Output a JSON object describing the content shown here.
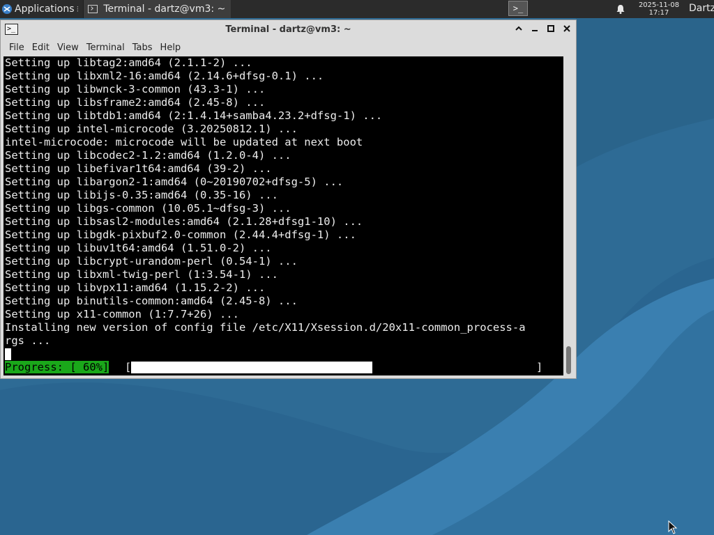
{
  "panel": {
    "applications_label": "Applications",
    "task_title": "Terminal - dartz@vm3: ~",
    "terminal_launcher": ">_",
    "clock_date": "2025-11-08",
    "clock_time": "17:17",
    "user": "Dartz"
  },
  "window": {
    "title": "Terminal - dartz@vm3: ~",
    "menu": [
      "File",
      "Edit",
      "View",
      "Terminal",
      "Tabs",
      "Help"
    ]
  },
  "terminal": {
    "lines": [
      "Setting up libtag2:amd64 (2.1.1-2) ...",
      "Setting up libxml2-16:amd64 (2.14.6+dfsg-0.1) ...",
      "Setting up libwnck-3-common (43.3-1) ...",
      "Setting up libsframe2:amd64 (2.45-8) ...",
      "Setting up libtdb1:amd64 (2:1.4.14+samba4.23.2+dfsg-1) ...",
      "Setting up intel-microcode (3.20250812.1) ...",
      "intel-microcode: microcode will be updated at next boot",
      "Setting up libcodec2-1.2:amd64 (1.2.0-4) ...",
      "Setting up libefivar1t64:amd64 (39-2) ...",
      "Setting up libargon2-1:amd64 (0~20190702+dfsg-5) ...",
      "Setting up libijs-0.35:amd64 (0.35-16) ...",
      "Setting up libgs-common (10.05.1~dfsg-3) ...",
      "Setting up libsasl2-modules:amd64 (2.1.28+dfsg1-10) ...",
      "Setting up libgdk-pixbuf2.0-common (2.44.4+dfsg-1) ...",
      "Setting up libuv1t64:amd64 (1.51.0-2) ...",
      "Setting up libcrypt-urandom-perl (0.54-1) ...",
      "Setting up libxml-twig-perl (1:3.54-1) ...",
      "Setting up libvpx11:amd64 (1.15.2-2) ...",
      "Setting up binutils-common:amd64 (2.45-8) ...",
      "Setting up x11-common (1:7.7+26) ...",
      "Installing new version of config file /etc/X11/Xsession.d/20x11-common_process-a",
      "rgs ..."
    ],
    "progress_label": "Progress: [ 60%]",
    "progress_open": "[",
    "progress_close": "]",
    "progress_fraction": 0.6
  }
}
